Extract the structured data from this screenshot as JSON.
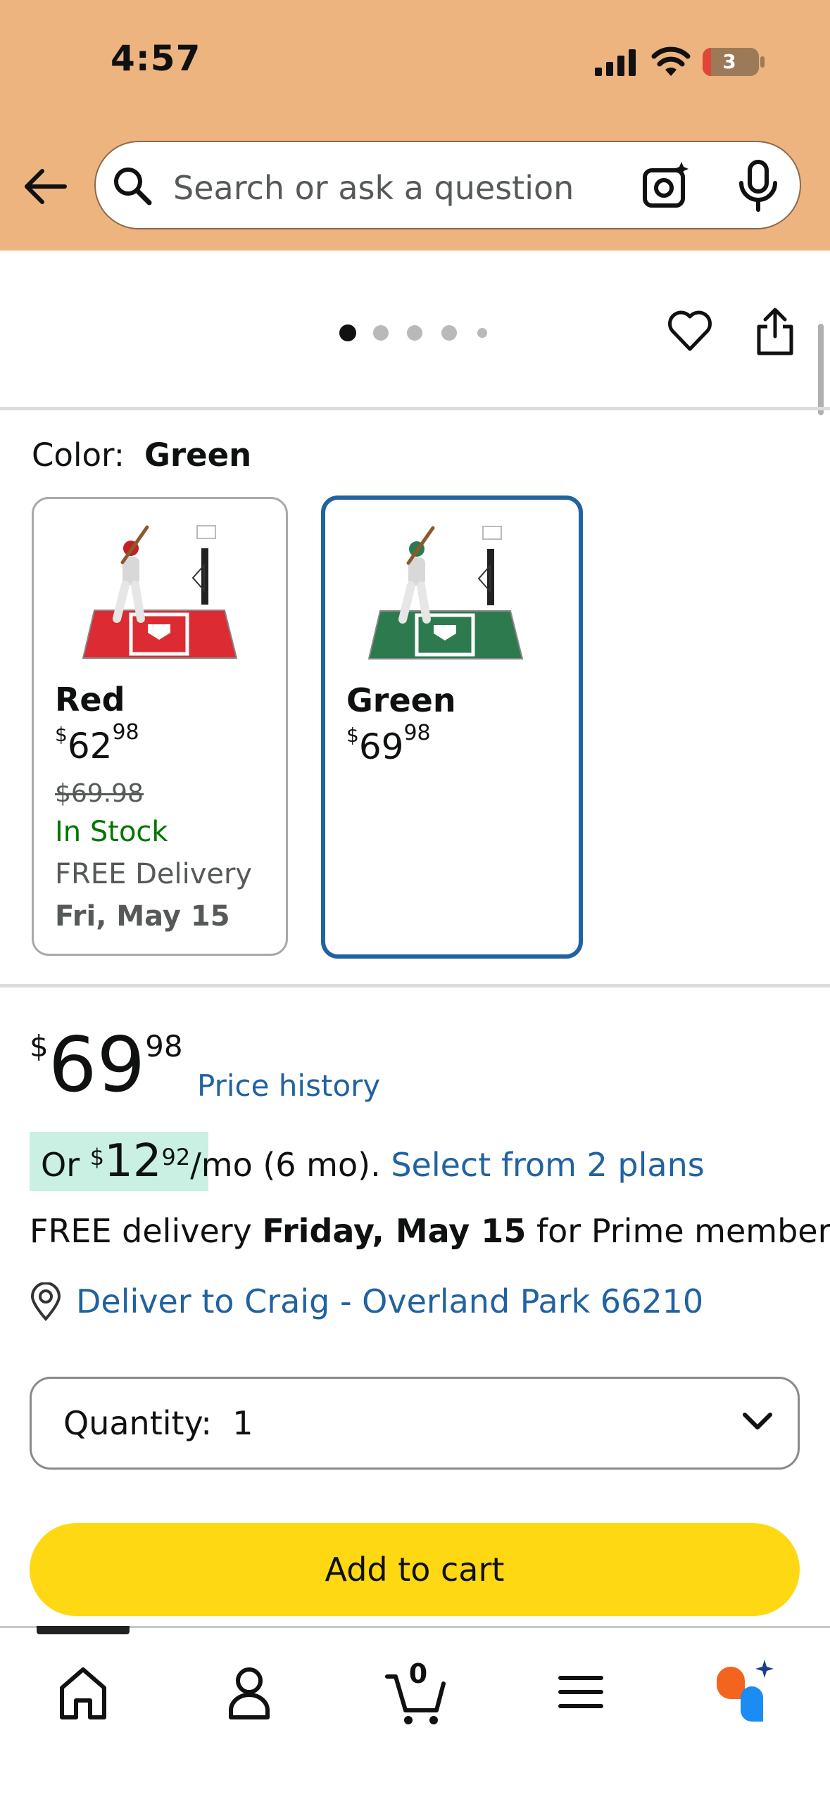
{
  "status_bar": {
    "time": "4:57",
    "battery": "3"
  },
  "search": {
    "placeholder": "Search or ask a question"
  },
  "carousel": {
    "dots": 5,
    "active": 0
  },
  "color_selector": {
    "label": "Color:",
    "selected": "Green",
    "options": [
      {
        "name": "Red",
        "price_dollars": "62",
        "price_cents": "98",
        "list_price": "$69.98",
        "stock": "In Stock",
        "delivery": "FREE Delivery",
        "delivery_date": "Fri, May 15"
      },
      {
        "name": "Green",
        "price_dollars": "69",
        "price_cents": "98"
      }
    ]
  },
  "price": {
    "currency": "$",
    "dollars": "69",
    "cents": "98",
    "history_link": "Price history"
  },
  "installment": {
    "prefix": "Or ",
    "currency": "$",
    "dollars": "12",
    "cents": "92",
    "term": "/mo (6 mo).",
    "link": "Select from 2 plans"
  },
  "delivery": {
    "prefix": "FREE delivery ",
    "date": "Friday, May 15",
    "suffix": " for Prime members"
  },
  "deliver_to": "Deliver to Craig - Overland Park 66210",
  "quantity": {
    "label": "Quantity:",
    "value": "1"
  },
  "add_to_cart": "Add to cart",
  "cart_count": "0",
  "colors": {
    "header": "#edb47f",
    "link": "#2162a1",
    "cart_button": "#ffd814",
    "in_stock": "#007600",
    "selected_border": "#2162a1"
  }
}
